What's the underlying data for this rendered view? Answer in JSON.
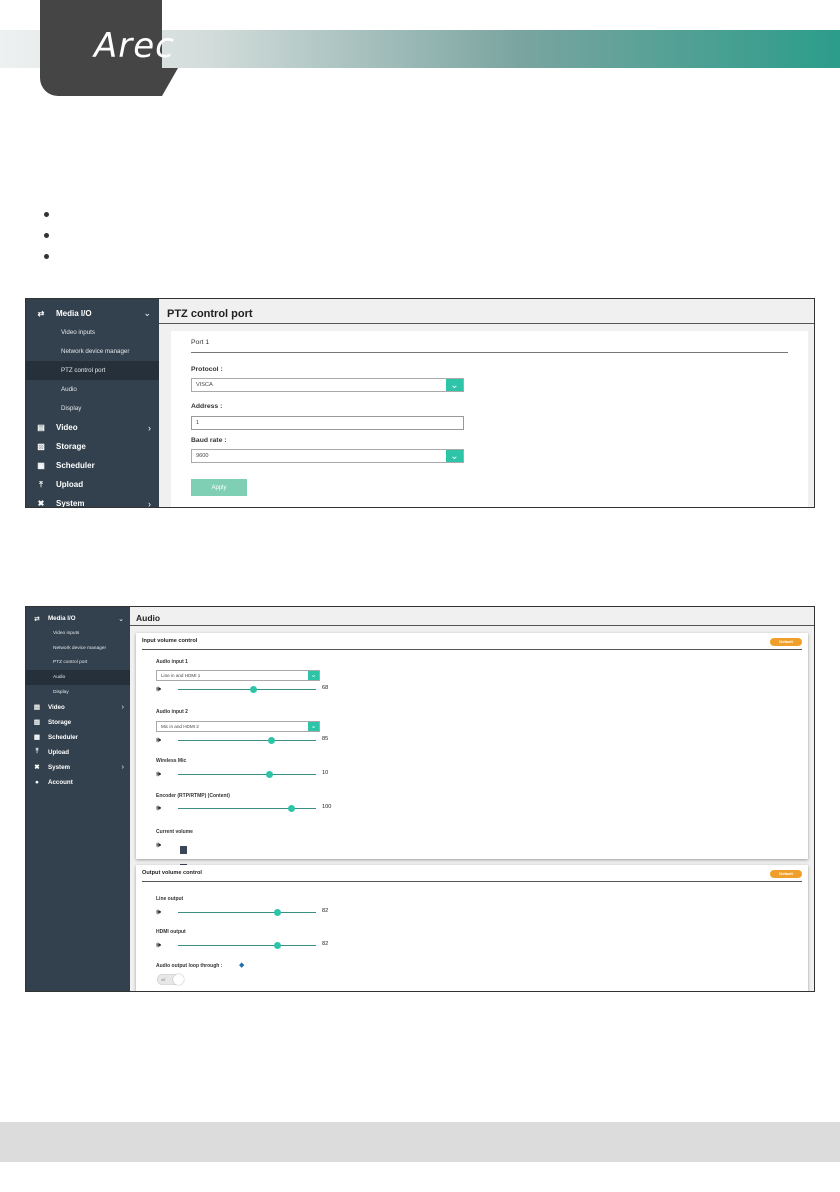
{
  "brand": {
    "logo_text": "Arec"
  },
  "ptz_screen": {
    "sidebar": {
      "items": [
        {
          "label": "Media I/O",
          "icon": "media-io-icon",
          "chevron": "⌵"
        },
        {
          "label": "Video inputs"
        },
        {
          "label": "Network device manager"
        },
        {
          "label": "PTZ control port",
          "active": true
        },
        {
          "label": "Audio"
        },
        {
          "label": "Display"
        },
        {
          "label": "Video",
          "icon": "video-icon",
          "chevron": "›"
        },
        {
          "label": "Storage",
          "icon": "storage-icon"
        },
        {
          "label": "Scheduler",
          "icon": "scheduler-icon"
        },
        {
          "label": "Upload",
          "icon": "upload-icon"
        },
        {
          "label": "System",
          "icon": "system-icon",
          "chevron": "›"
        }
      ]
    },
    "title": "PTZ control port",
    "port_title": "Port 1",
    "protocol_label": "Protocol :",
    "protocol_value": "VISCA",
    "address_label": "Address :",
    "address_value": "1",
    "baud_label": "Baud rate :",
    "baud_value": "9600",
    "apply_label": "Apply",
    "colors": {
      "sidebar": "#33404d",
      "accent": "#2ec4a8",
      "apply": "#7fcfb5"
    }
  },
  "audio_screen": {
    "sidebar": {
      "items": [
        {
          "label": "Media I/O"
        },
        {
          "label": "Video inputs"
        },
        {
          "label": "Network device manager"
        },
        {
          "label": "PTZ control port"
        },
        {
          "label": "Audio",
          "active": true
        },
        {
          "label": "Display"
        },
        {
          "label": "Video"
        },
        {
          "label": "Storage"
        },
        {
          "label": "Scheduler"
        },
        {
          "label": "Upload"
        },
        {
          "label": "System"
        },
        {
          "label": "Account"
        }
      ]
    },
    "title": "Audio",
    "input_panel": {
      "title": "Input volume control",
      "default_label": "Default",
      "audio_input_1": {
        "label": "Audio input 1",
        "select": "Line in and HDMI 1",
        "value": "68",
        "level": 0.55
      },
      "audio_input_2": {
        "label": "Audio input 2",
        "select": "Mic in and HDMI 2",
        "value": "85",
        "level": 0.68
      },
      "wireless_mic": {
        "label": "Wireless Mic",
        "value": "10",
        "level": 0.66
      },
      "encoder": {
        "label": "Encoder (RTP/RTMP) (Content)",
        "value": "100",
        "level": 0.82
      },
      "current_volume": {
        "label": "Current volume",
        "bars": 7
      }
    },
    "output_panel": {
      "title": "Output volume control",
      "default_label": "Default",
      "line_output": {
        "label": "Line output",
        "value": "82",
        "level": 0.72
      },
      "hdmi_output": {
        "label": "HDMI output",
        "value": "82",
        "level": 0.72
      },
      "loop_label": "Audio output loop through :",
      "loop_toggle": "off"
    },
    "colors": {
      "badge": "#f0a02a",
      "slider": "#2ec4a8",
      "meter": "#3c4656"
    }
  }
}
